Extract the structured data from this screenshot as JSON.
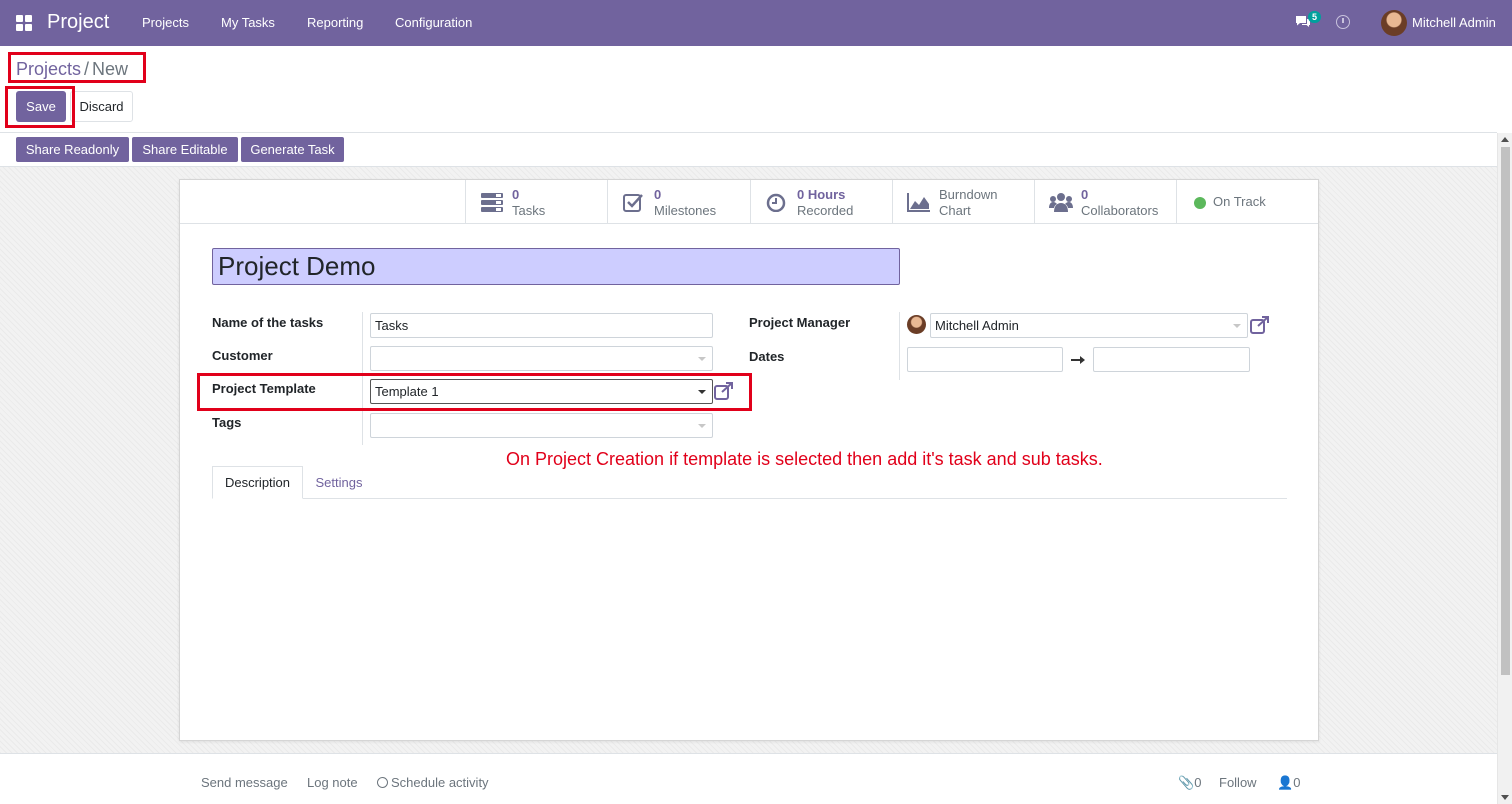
{
  "navbar": {
    "brand": "Project",
    "menu": [
      "Projects",
      "My Tasks",
      "Reporting",
      "Configuration"
    ],
    "chat_count": "5",
    "user": "Mitchell Admin"
  },
  "breadcrumb": {
    "parent": "Projects",
    "separator": "/",
    "current": "New"
  },
  "actions": {
    "save": "Save",
    "discard": "Discard"
  },
  "header_buttons": [
    "Share Readonly",
    "Share Editable",
    "Generate Task"
  ],
  "stats": [
    {
      "value": "0",
      "label": "Tasks",
      "icon": "tasks-icon"
    },
    {
      "value": "0",
      "label": "Milestones",
      "icon": "check-square-icon"
    },
    {
      "value": "0 Hours",
      "label": "Recorded",
      "icon": "clock-icon"
    },
    {
      "value": "Burndown",
      "label": "Chart",
      "icon": "area-chart-icon"
    },
    {
      "value": "0",
      "label": "Collaborators",
      "icon": "users-icon"
    }
  ],
  "status": {
    "label": "On Track",
    "color": "#5cb85c"
  },
  "form": {
    "title": "Project Demo",
    "name_of_tasks": {
      "label": "Name of the tasks",
      "value": "Tasks"
    },
    "customer": {
      "label": "Customer",
      "value": ""
    },
    "project_template": {
      "label": "Project Template",
      "value": "Template 1"
    },
    "tags": {
      "label": "Tags",
      "value": ""
    },
    "project_manager": {
      "label": "Project Manager",
      "value": "Mitchell Admin"
    },
    "dates": {
      "label": "Dates",
      "start": "",
      "end": ""
    }
  },
  "annotation": "On Project Creation if template is selected then add it's task and sub tasks.",
  "tabs": [
    "Description",
    "Settings"
  ],
  "chatter": {
    "send_message": "Send message",
    "log_note": "Log note",
    "schedule_activity": "Schedule activity",
    "attachments": "0",
    "follow": "Follow",
    "followers": "0"
  },
  "colors": {
    "primary": "#71639e",
    "highlight": "#e1001a",
    "title_bg": "#cdcdff"
  }
}
